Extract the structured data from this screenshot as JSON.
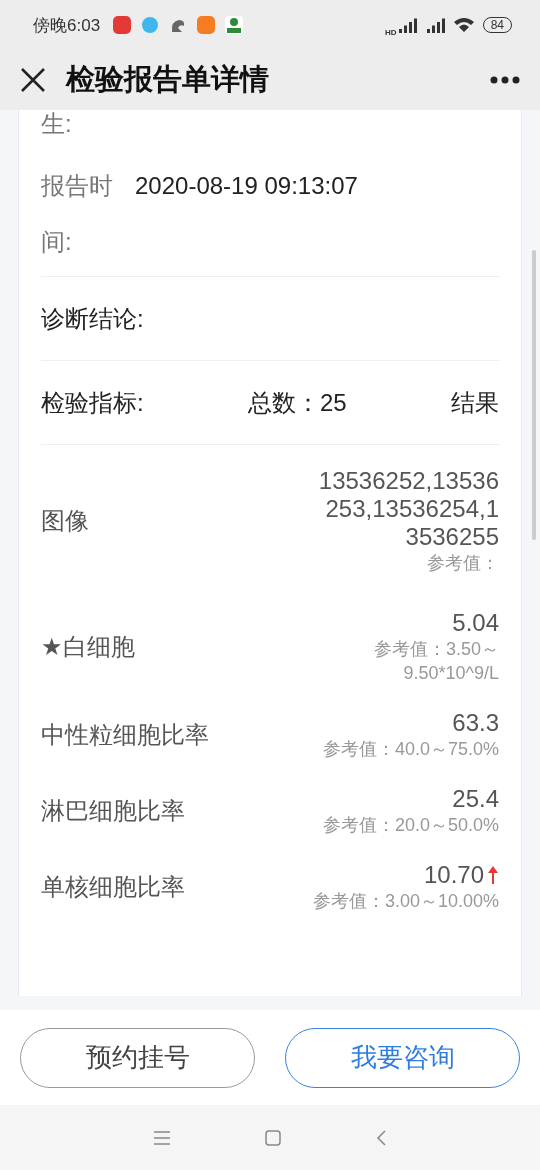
{
  "status_bar": {
    "time": "傍晚6:03",
    "battery": "84",
    "network": "HD"
  },
  "header": {
    "title": "检验报告单详情"
  },
  "info": [
    {
      "label": "生:"
    },
    {
      "label": "报告时间:",
      "value": "2020-08-19 09:13:07"
    }
  ],
  "diagnosis": {
    "label": "诊断结论:"
  },
  "indicators": {
    "label": "检验指标:",
    "total": "总数：25",
    "result": "结果"
  },
  "items": [
    {
      "name": "图像",
      "value": "13536252,13536253,13536254,13536255",
      "reference": "参考值：",
      "high": false
    },
    {
      "name": "★白细胞",
      "value": "5.04",
      "reference": "参考值：3.50～9.50*10^9/L",
      "high": false
    },
    {
      "name": "中性粒细胞比率",
      "value": "63.3",
      "reference": "参考值：40.0～75.0%",
      "high": false
    },
    {
      "name": "淋巴细胞比率",
      "value": "25.4",
      "reference": "参考值：20.0～50.0%",
      "high": false
    },
    {
      "name": "单核细胞比率",
      "value": "10.70",
      "reference": "参考值：3.00～10.00%",
      "high": true
    }
  ],
  "actions": [
    {
      "label": "预约挂号",
      "primary": false
    },
    {
      "label": "我要咨询",
      "primary": true
    }
  ]
}
